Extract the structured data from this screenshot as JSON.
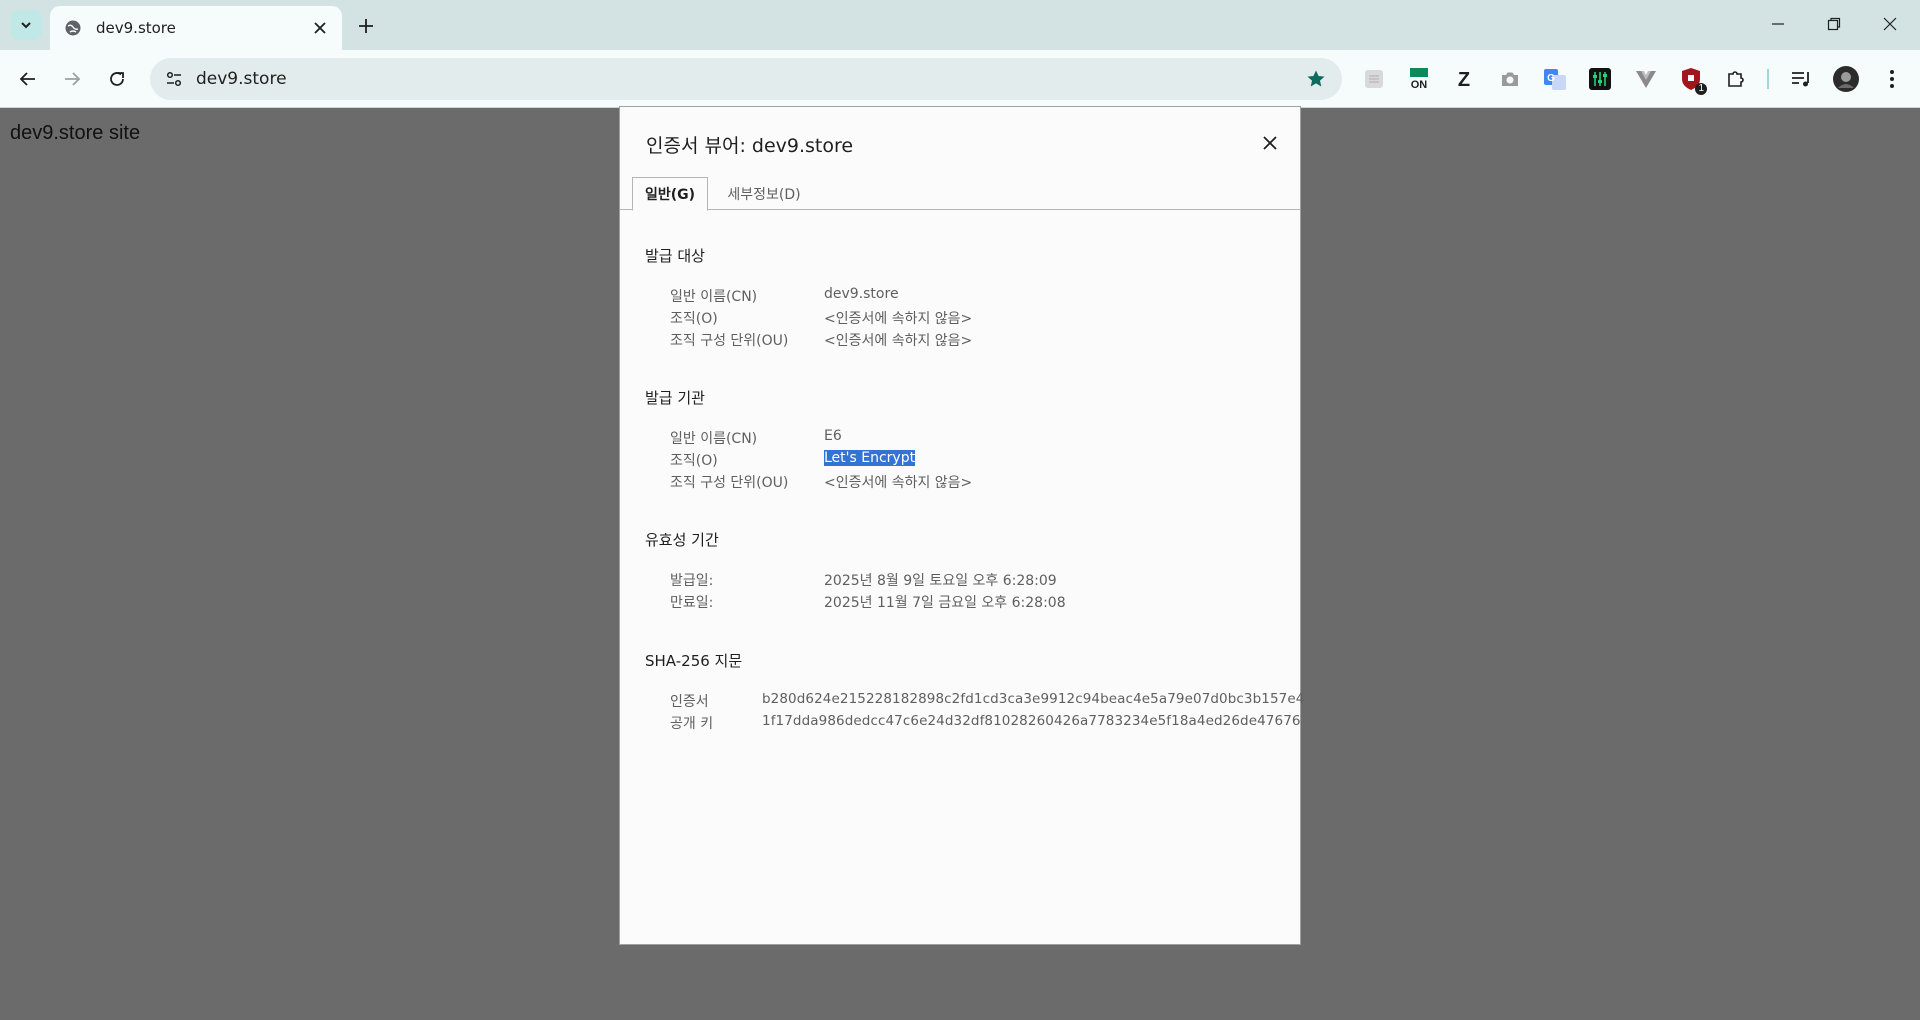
{
  "browser": {
    "tab_title": "dev9.store",
    "url": "dev9.store",
    "extensions": [
      {
        "name": "grid-extension-icon"
      },
      {
        "name": "on-extension-icon",
        "label": "ON"
      },
      {
        "name": "z-extension-icon",
        "label": "Z"
      },
      {
        "name": "camera-extension-icon"
      },
      {
        "name": "translate-extension-icon"
      },
      {
        "name": "equalizer-extension-icon"
      },
      {
        "name": "vue-extension-icon"
      },
      {
        "name": "shield-extension-icon",
        "badge": "1"
      },
      {
        "name": "puzzle-extensions-icon"
      }
    ]
  },
  "page": {
    "body_text": "dev9.store site"
  },
  "dialog": {
    "title": "인증서 뷰어: dev9.store",
    "tabs": [
      {
        "label": "일반(G)",
        "active": true
      },
      {
        "label": "세부정보(D)",
        "active": false
      }
    ],
    "issued_to": {
      "heading": "발급 대상",
      "rows": [
        {
          "label": "일반 이름(CN)",
          "value": "dev9.store"
        },
        {
          "label": "조직(O)",
          "value": "<인증서에 속하지 않음>"
        },
        {
          "label": "조직 구성 단위(OU)",
          "value": "<인증서에 속하지 않음>"
        }
      ]
    },
    "issued_by": {
      "heading": "발급 기관",
      "rows": [
        {
          "label": "일반 이름(CN)",
          "value": "E6"
        },
        {
          "label": "조직(O)",
          "value": "Let's Encrypt"
        },
        {
          "label": "조직 구성 단위(OU)",
          "value": "<인증서에 속하지 않음>"
        }
      ]
    },
    "validity": {
      "heading": "유효성 기간",
      "rows": [
        {
          "label": "발급일:",
          "value": "2025년 8월 9일 토요일 오후 6:28:09"
        },
        {
          "label": "만료일:",
          "value": "2025년 11월 7일 금요일 오후 6:28:08"
        }
      ]
    },
    "fingerprints": {
      "heading": "SHA-256 지문",
      "rows": [
        {
          "label": "인증서",
          "value": "b280d624e215228182898c2fd1cd3ca3e9912c94beac4e5a79e07d0bc3b157e4"
        },
        {
          "label": "공개 키",
          "value": "1f17dda986dedcc47c6e24d32df81028260426a7783234e5f18a4ed26de47676"
        }
      ]
    }
  },
  "colors": {
    "tabstrip": "#d3e3e3",
    "toolbar": "#f6fbfb",
    "page_overlay": "#6b6b6b",
    "selection": "#3373d6",
    "star": "#0b6b5e"
  }
}
